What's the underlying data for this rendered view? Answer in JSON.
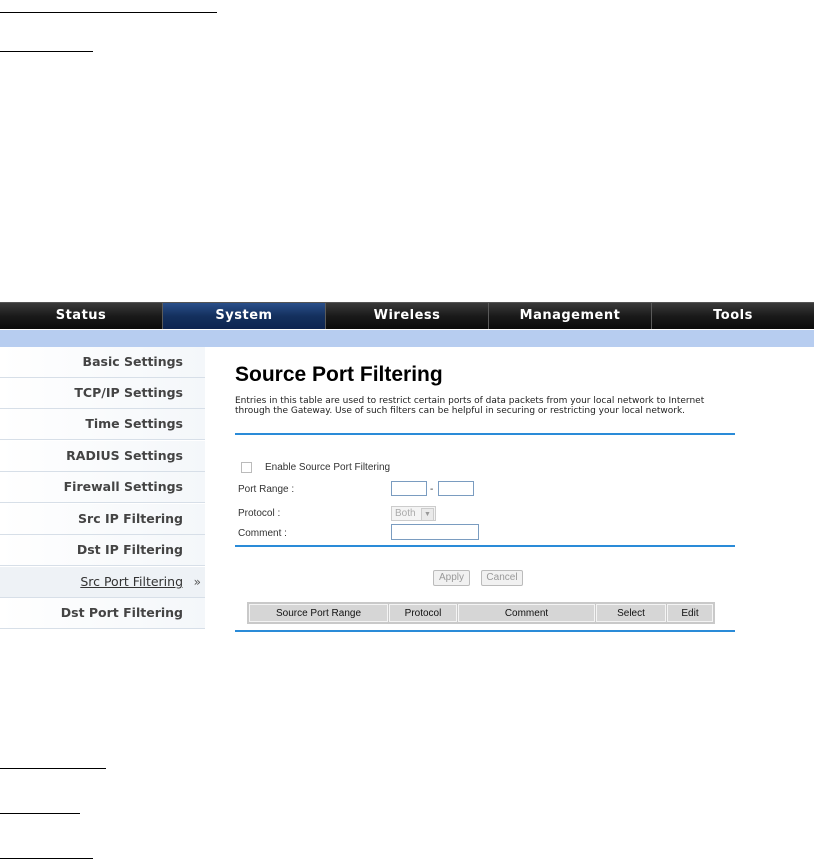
{
  "nav": {
    "tabs": [
      "Status",
      "System",
      "Wireless",
      "Management",
      "Tools"
    ],
    "active": "System"
  },
  "sidebar": {
    "items": [
      "Basic Settings",
      "TCP/IP Settings",
      "Time Settings",
      "RADIUS Settings",
      "Firewall Settings",
      "Src IP Filtering",
      "Dst IP Filtering",
      "Src Port Filtering",
      "Dst Port Filtering"
    ],
    "active_index": 7,
    "active_marker": "»"
  },
  "page": {
    "title": "Source Port Filtering",
    "description": "Entries in this table are used to restrict certain ports of data packets from your local network to Internet through the Gateway. Use of such filters can be helpful in securing or restricting your local network."
  },
  "form": {
    "enable_label": "Enable Source Port Filtering",
    "enable_checked": false,
    "port_range_label": "Port Range :",
    "port_range_separator": "-",
    "port_from": "",
    "port_to": "",
    "protocol_label": "Protocol :",
    "protocol_value": "Both",
    "comment_label": "Comment :",
    "comment_value": "",
    "apply_label": "Apply",
    "cancel_label": "Cancel"
  },
  "table": {
    "columns": [
      "Source Port Range",
      "Protocol",
      "Comment",
      "Select",
      "Edit"
    ],
    "rows": []
  },
  "colors": {
    "accent_rule": "#2a8bd8",
    "nav_active": "#14305e",
    "subbar": "#b7cdf0"
  }
}
